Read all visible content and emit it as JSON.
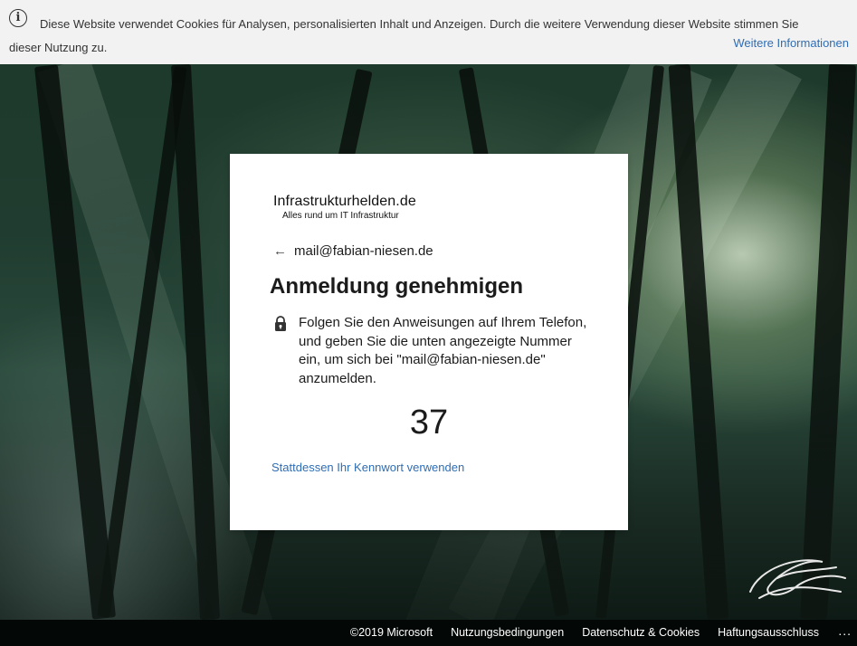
{
  "cookie_banner": {
    "text": "Diese Website verwendet Cookies für Analysen, personalisierten Inhalt und Anzeigen. Durch die weitere Verwendung dieser Website stimmen Sie dieser Nutzung zu.",
    "more_info_label": "Weitere Informationen",
    "icon": "info-icon"
  },
  "card": {
    "logo": {
      "title": "Infrastrukturhelden.de",
      "subtitle": "Alles rund um IT Infrastruktur"
    },
    "identity": {
      "back_icon": "back-arrow-icon",
      "email": "mail@fabian-niesen.de"
    },
    "title": "Anmeldung genehmigen",
    "instruction": {
      "icon": "lock-icon",
      "text": "Folgen Sie den Anweisungen auf Ihrem Telefon, und geben Sie die unten angezeigte Nummer ein, um sich bei \"mail@fabian-niesen.de\" anzumelden."
    },
    "number": "37",
    "alt_link": "Stattdessen Ihr Kennwort verwenden"
  },
  "footer": {
    "copyright": "©2019 Microsoft",
    "terms": "Nutzungsbedingungen",
    "privacy": "Datenschutz & Cookies",
    "imprint": "Haftungsausschluss",
    "more": "..."
  },
  "colors": {
    "link": "#2f6db5",
    "banner_bg": "#f2f2f2",
    "footer_bg": "#000000"
  }
}
